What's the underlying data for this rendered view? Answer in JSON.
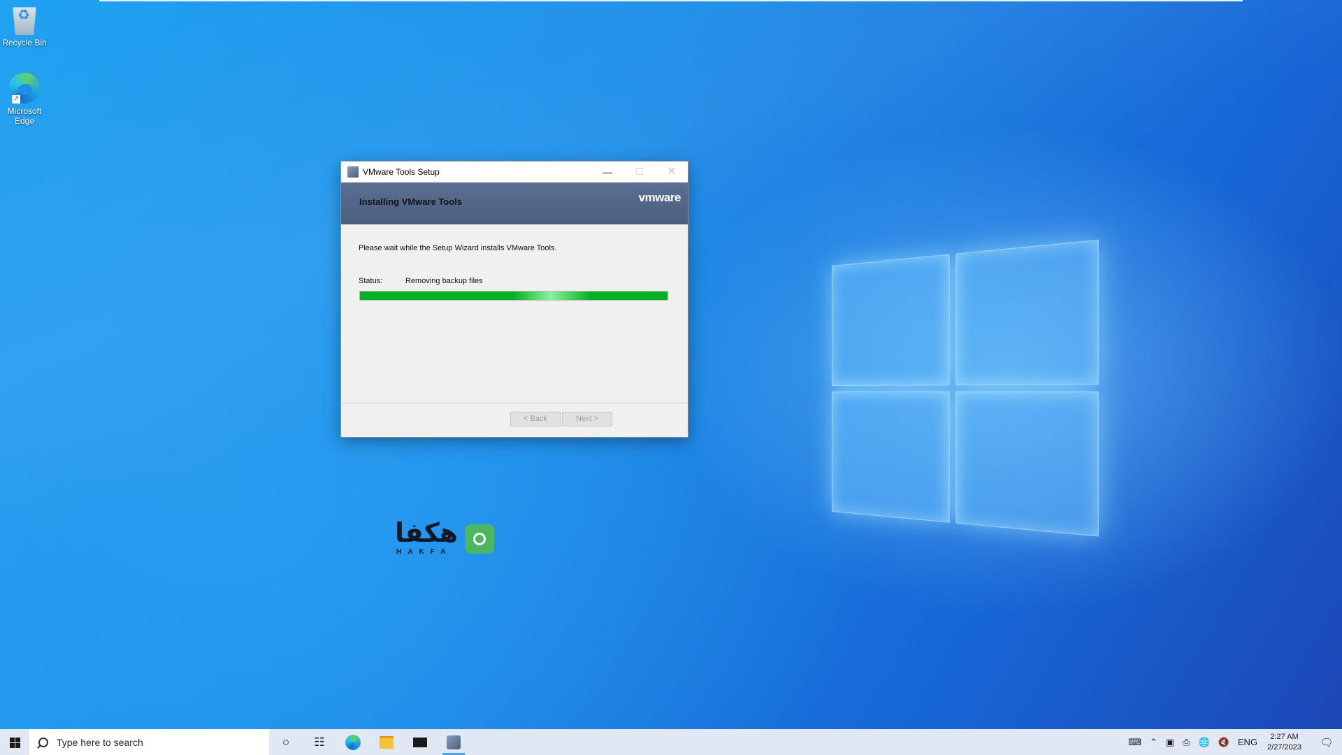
{
  "desktop": {
    "icons": [
      {
        "label": "Recycle Bin",
        "icon": "recycle-bin-icon"
      },
      {
        "label": "Microsoft Edge",
        "icon": "edge-icon"
      }
    ],
    "watermark": {
      "text": "هکفا",
      "subtext": "HAKFA"
    }
  },
  "dialog": {
    "title": "VMware Tools Setup",
    "banner_title": "Installing VMware Tools",
    "logo": "vmware",
    "instruction": "Please wait while the Setup Wizard installs VMware Tools.",
    "status_label": "Status:",
    "status_value": "Removing backup files",
    "progress": 1.0,
    "progress_color": "#06b025",
    "buttons": {
      "back": "< Back",
      "next": "Next >"
    }
  },
  "taskbar": {
    "search_placeholder": "Type here to search",
    "language": "ENG",
    "time": "2:27 AM",
    "date": "2/27/2023"
  }
}
